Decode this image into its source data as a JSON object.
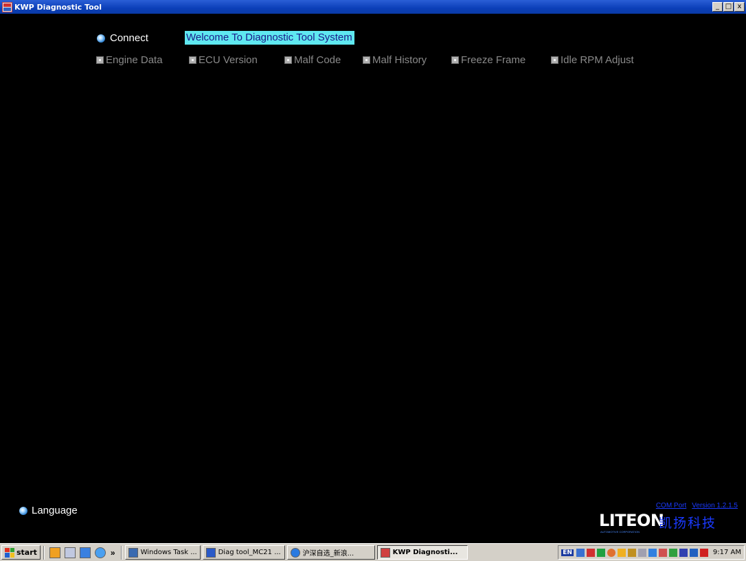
{
  "window": {
    "title": "KWP Diagnostic Tool",
    "controls": {
      "minimize": "_",
      "maximize": "□",
      "close": "x"
    }
  },
  "main": {
    "connect_label": "Connect",
    "welcome_text": "Welcome To Diagnostic Tool System",
    "menu": [
      {
        "label": "Engine Data"
      },
      {
        "label": "ECU Version"
      },
      {
        "label": "Malf Code"
      },
      {
        "label": "Malf History"
      },
      {
        "label": "Freeze Frame"
      },
      {
        "label": "Idle RPM Adjust"
      }
    ],
    "language_label": "Language",
    "com_port_label": "COM Port",
    "version_label": "Version 1.2.1.5",
    "brand": {
      "name": "LITEON",
      "sub": "AUTOMOTIVE CORPORATION",
      "chinese": "凯扬科技"
    }
  },
  "taskbar": {
    "start_label": "start",
    "overflow": "»",
    "tasks": [
      {
        "label": "Windows Task ...",
        "icon_color": "#3a6ab0"
      },
      {
        "label": "Diag tool_MC21 ...",
        "icon_color": "#2a5ac8"
      },
      {
        "label": "沪深自选_新浪...",
        "icon_color": "#2a7ae0"
      },
      {
        "label": "KWP Diagnosti...",
        "icon_color": "#d04040",
        "active": true
      }
    ],
    "tray_lang": "EN",
    "clock": "9:17 AM"
  },
  "colors": {
    "accent": "#5fe8f0",
    "menu_disabled": "#8a8a8a",
    "link": "#1a3aff"
  }
}
